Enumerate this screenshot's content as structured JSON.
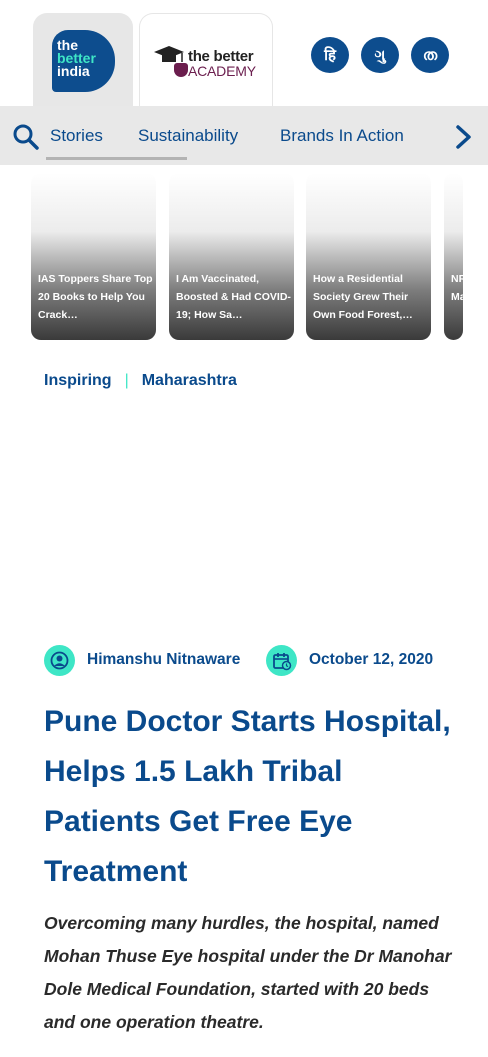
{
  "brands": {
    "tbi": {
      "line1": "the",
      "line2": "better",
      "line3": "india"
    },
    "academy": {
      "line1": "the better",
      "line2": "ACADEMY"
    }
  },
  "languages": [
    "हि",
    "ગુ",
    "ത"
  ],
  "nav": {
    "items": [
      "Stories",
      "Sustainability",
      "Brands In Action"
    ],
    "active": "Stories"
  },
  "cards": [
    {
      "title": "IAS Toppers Share Top 20 Books to Help You Crack…"
    },
    {
      "title": "I Am Vaccinated, Boosted & Had COVID-19; How Sa…"
    },
    {
      "title": "How a Residential Society Grew Their Own Food Forest,…"
    },
    {
      "title": "NR Ma Ze"
    }
  ],
  "tags": [
    "Inspiring",
    "Maharashtra"
  ],
  "article": {
    "author": "Himanshu Nitnaware",
    "date": "October 12, 2020",
    "headline": "Pune Doctor Starts Hospital, Helps 1.5 Lakh Tribal Patients Get Free Eye Treatment",
    "excerpt": "Overcoming many hurdles, the hospital, named Mohan Thuse Eye hospital under the Dr Manohar Dole Medical Foundation, started with 20 beds and one operation theatre."
  },
  "colors": {
    "brand_blue": "#0d4d8e",
    "accent_mint": "#3ee6c6",
    "academy_plum": "#6b1e4e",
    "nav_bg": "#e8e8e8"
  },
  "icons": {
    "search": "search-icon",
    "next": "chevron-right-icon",
    "author": "user-circle-icon",
    "date": "calendar-clock-icon"
  }
}
